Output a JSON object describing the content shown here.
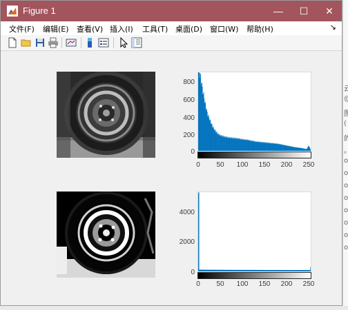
{
  "window": {
    "title": "Figure 1",
    "title_bar_color": "#a2555d",
    "controls": {
      "minimize": "—",
      "maximize": "☐",
      "close": "✕"
    }
  },
  "menu": {
    "items": [
      "文件(F)",
      "编辑(E)",
      "查看(V)",
      "插入(I)",
      "工具(T)",
      "桌面(D)",
      "窗口(W)",
      "帮助(H)"
    ],
    "overflow_arrow": "↘"
  },
  "toolbar": {
    "icons": [
      "new-figure-icon",
      "open-file-icon",
      "save-icon",
      "print-icon",
      "link-plot-icon",
      "insert-colorbar-icon",
      "insert-legend-icon",
      "edit-plot-arrow-icon",
      "property-inspector-icon"
    ]
  },
  "figure": {
    "top_image": {
      "description": "grayscale tire wheel",
      "type": "image"
    },
    "bottom_image": {
      "description": "high-contrast tire wheel",
      "type": "image"
    }
  },
  "chart_data": [
    {
      "type": "bar",
      "xlim": [
        0,
        255
      ],
      "ylim": [
        0,
        900
      ],
      "xticks": [
        "0",
        "50",
        "100",
        "150",
        "200",
        "250"
      ],
      "yticks": [
        "0",
        "200",
        "400",
        "600",
        "800"
      ],
      "colorbar": "grayscale",
      "bar_color": "#0072bd",
      "series": [
        {
          "points": [
            [
              0,
              900
            ],
            [
              2,
              900
            ],
            [
              4,
              860
            ],
            [
              6,
              800
            ],
            [
              8,
              740
            ],
            [
              10,
              680
            ],
            [
              13,
              600
            ],
            [
              16,
              520
            ],
            [
              20,
              430
            ],
            [
              25,
              360
            ],
            [
              30,
              300
            ],
            [
              35,
              250
            ],
            [
              40,
              215
            ],
            [
              45,
              190
            ],
            [
              50,
              175
            ],
            [
              60,
              160
            ],
            [
              70,
              150
            ],
            [
              80,
              145
            ],
            [
              90,
              140
            ],
            [
              100,
              130
            ],
            [
              110,
              125
            ],
            [
              120,
              115
            ],
            [
              130,
              105
            ],
            [
              140,
              100
            ],
            [
              150,
              95
            ],
            [
              160,
              90
            ],
            [
              170,
              85
            ],
            [
              180,
              80
            ],
            [
              190,
              70
            ],
            [
              200,
              60
            ],
            [
              210,
              50
            ],
            [
              220,
              40
            ],
            [
              230,
              35
            ],
            [
              240,
              25
            ],
            [
              245,
              20
            ],
            [
              250,
              60
            ],
            [
              253,
              25
            ],
            [
              255,
              10
            ]
          ]
        }
      ]
    },
    {
      "type": "bar",
      "xlim": [
        0,
        255
      ],
      "ylim": [
        0,
        5400
      ],
      "xticks": [
        "0",
        "50",
        "100",
        "150",
        "200",
        "250"
      ],
      "yticks": [
        "0",
        "2000",
        "4000"
      ],
      "colorbar": "grayscale",
      "bar_color": "#0072bd",
      "series": [
        {
          "points": [
            [
              0,
              5300
            ],
            [
              1,
              5300
            ],
            [
              2,
              120
            ],
            [
              10,
              115
            ],
            [
              30,
              110
            ],
            [
              60,
              105
            ],
            [
              90,
              100
            ],
            [
              120,
              100
            ],
            [
              150,
              95
            ],
            [
              180,
              95
            ],
            [
              210,
              90
            ],
            [
              240,
              90
            ],
            [
              253,
              85
            ],
            [
              254,
              300
            ],
            [
              255,
              300
            ]
          ]
        }
      ]
    }
  ],
  "background_window": {
    "right_strip_text": [
      "云",
      "@",
      "图",
      "(",
      "的",
      "。",
      "ot",
      "ot",
      "ot",
      "ot",
      "ot",
      "ot",
      "ot",
      "ot"
    ]
  }
}
